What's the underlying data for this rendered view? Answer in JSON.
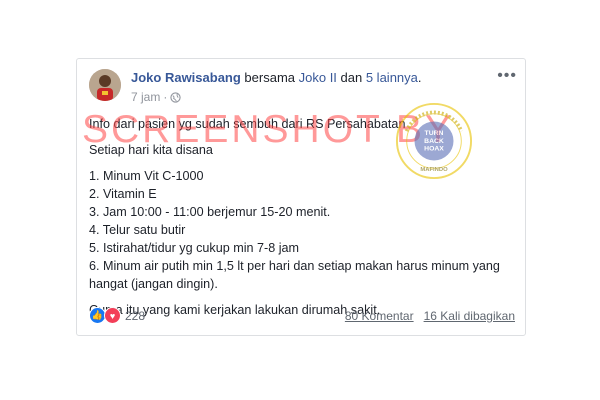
{
  "post": {
    "author": "Joko Rawisabang",
    "with_text": " bersama ",
    "tagged_name": "Joko II",
    "and_text": " dan ",
    "others": "5 lainnya",
    "period": ".",
    "time": "7 jam",
    "dot": "·",
    "body": {
      "line1": "Info dari pasien yg sudah sembuh dari RS Persahabatan",
      "line2": "Setiap hari kita disana",
      "items": [
        "1. Minum Vit C-1000",
        "2. Vitamin E",
        "3. Jam 10:00 - 11:00 berjemur 15-20 menit.",
        "4. Telur satu butir",
        "5. Istirahat/tidur yg cukup min 7-8 jam",
        "6. Minum air putih min 1,5 lt per hari dan setiap makan harus minum yang hangat (jangan dingin)."
      ],
      "closing": "Cuma itu yang kami kerjakan lakukan dirumah sakit."
    },
    "reaction_count": "228",
    "comments": "80 Komentar",
    "shares": "16 Kali dibagikan"
  },
  "icons": {
    "more": "more-options-icon",
    "globe": "globe-icon",
    "like": "like-reaction-icon",
    "love": "love-reaction-icon"
  },
  "watermark": {
    "text": "SCREENSHOT BY",
    "seal_top": "MASYARAKAT ANTI FITNAH INDONESIA",
    "seal_mid1": "TURN",
    "seal_mid2": "BACK",
    "seal_mid3": "HOAX",
    "seal_bottom": "MAFINDO"
  },
  "colors": {
    "link": "#385898",
    "text": "#1d2129",
    "muted": "#90949c",
    "like": "#1877f2",
    "love": "#f33e58",
    "watermark": "#ff4646",
    "seal": "#e8c200"
  }
}
